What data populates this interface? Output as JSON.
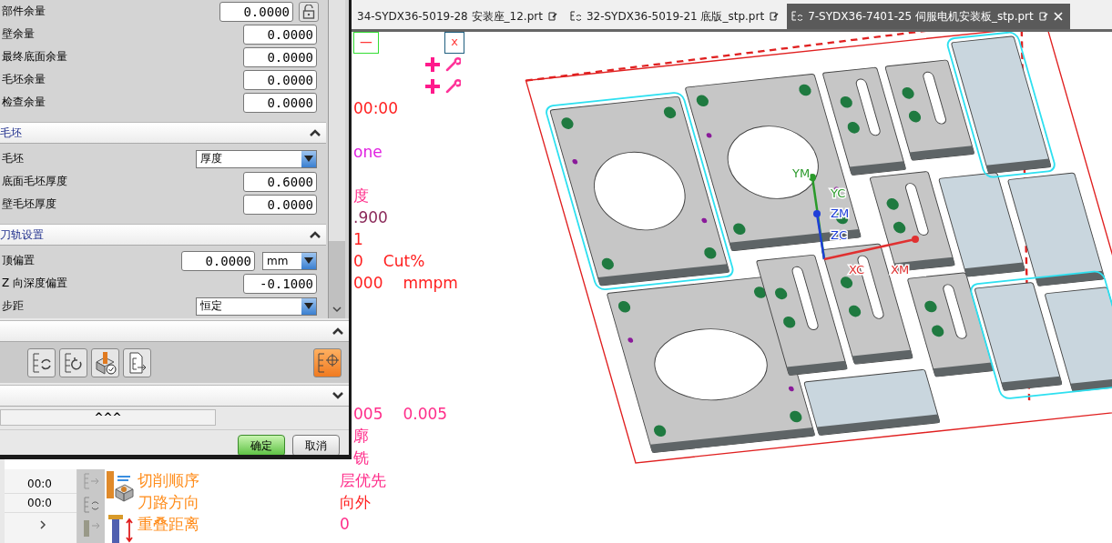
{
  "dialog": {
    "sections": [
      {
        "kind": "plain",
        "rows": [
          {
            "kind": "number_lock",
            "label": "部件余量",
            "value": "0.0000"
          },
          {
            "kind": "number",
            "label": "壁余量",
            "value": "0.0000"
          },
          {
            "kind": "number",
            "label": "最终底面余量",
            "value": "0.0000"
          },
          {
            "kind": "number",
            "label": "毛坯余量",
            "value": "0.0000"
          },
          {
            "kind": "number",
            "label": "检查余量",
            "value": "0.0000"
          }
        ]
      },
      {
        "kind": "group",
        "title": "毛坯",
        "expanded": true,
        "rows": [
          {
            "kind": "dropdown",
            "label": "毛坯",
            "value": "厚度"
          },
          {
            "kind": "number",
            "label": "底面毛坯厚度",
            "value": "0.6000"
          },
          {
            "kind": "number",
            "label": "壁毛坯厚度",
            "value": "0.0000"
          }
        ]
      },
      {
        "kind": "group",
        "title": "刀轨设置",
        "expanded": true,
        "rows": [
          {
            "kind": "number_unit",
            "label": "顶偏置",
            "value": "0.0000",
            "unit": "mm"
          },
          {
            "kind": "number",
            "label": "Z 向深度偏置",
            "value": "-0.1000"
          },
          {
            "kind": "dropdown",
            "label": "步距",
            "value": "恒定"
          }
        ]
      }
    ],
    "actions": {
      "expanded": true,
      "tools": [
        {
          "kind": "generate",
          "selected": false
        },
        {
          "kind": "replay",
          "selected": false
        },
        {
          "kind": "verify",
          "selected": false
        },
        {
          "kind": "list",
          "selected": false
        },
        {
          "kind": "display",
          "selected": true
        }
      ]
    },
    "options": {
      "expanded": false
    },
    "more_toggle": "^^^",
    "buttons": [
      {
        "label": "确定",
        "default": true
      },
      {
        "label": "取消",
        "default": false
      }
    ]
  },
  "tabs": [
    {
      "label": "34-SYDX36-5019-28 安装座_12.prt",
      "selected": false
    },
    {
      "label": "32-SYDX36-5019-21 底版_stp.prt",
      "kind": "synced",
      "selected": false
    },
    {
      "label": "7-SYDX36-7401-25 伺服电机安装板_stp.prt",
      "kind": "synced",
      "selected": true
    }
  ],
  "params": {
    "controls": [
      {
        "kind": "minimize",
        "label": "一"
      },
      {
        "kind": "close",
        "label": "x"
      }
    ],
    "add_rows": [
      {
        "kind": "add"
      },
      {
        "kind": "add"
      }
    ],
    "rows": [
      {
        "kind": "value_only",
        "values": [
          {
            "text": "00:00",
            "color": "#ff2020"
          }
        ]
      },
      {
        "kind": "blank"
      },
      {
        "kind": "value_only",
        "values": [
          {
            "text": "one",
            "color": "#e020e0"
          }
        ]
      },
      {
        "kind": "blank"
      },
      {
        "kind": "value_only",
        "values": [
          {
            "text": "度",
            "color": "#ff2d8a"
          }
        ]
      },
      {
        "kind": "value_only",
        "values": [
          {
            "text": ".900",
            "color": "#8b2a5a"
          }
        ]
      },
      {
        "kind": "value_only",
        "values": [
          {
            "text": "1",
            "color": "#ff2020"
          }
        ]
      },
      {
        "kind": "value_only",
        "values": [
          {
            "text": "0",
            "color": "#ff2020"
          },
          {
            "text": "Cut%",
            "color": "#ff2020"
          }
        ]
      },
      {
        "kind": "value_only",
        "values": [
          {
            "text": "000",
            "color": "#ff2020"
          },
          {
            "text": "mmpm",
            "color": "#ff2020"
          }
        ]
      },
      {
        "kind": "blank"
      },
      {
        "kind": "blank"
      },
      {
        "kind": "blank"
      },
      {
        "kind": "blank"
      },
      {
        "kind": "blank"
      },
      {
        "kind": "value_only",
        "values": [
          {
            "text": "005",
            "color": "#ff2d8a"
          },
          {
            "text": "0.005",
            "color": "#ff2d8a"
          }
        ]
      },
      {
        "kind": "value_only",
        "values": [
          {
            "text": "廓",
            "color": "#ff2d8a"
          }
        ]
      },
      {
        "kind": "value_only",
        "values": [
          {
            "text": "铣",
            "color": "#ff2d8a"
          }
        ]
      }
    ]
  },
  "lower": {
    "table_cells": [
      "00:0",
      "00:0"
    ],
    "tools": [
      {
        "kind": "list"
      },
      {
        "kind": "replay"
      },
      {
        "kind": "cutter"
      }
    ],
    "rows": [
      {
        "label": "切削顺序",
        "values": [
          {
            "text": "层优先",
            "color": "#ff2d8a"
          }
        ]
      },
      {
        "label": "刀路方向",
        "values": [
          {
            "text": "向外",
            "color": "#ff2020"
          }
        ]
      },
      {
        "label": "重叠距离",
        "values": [
          {
            "text": "0",
            "color": "#ff2d8a"
          }
        ]
      }
    ]
  },
  "viewport": {
    "axes": [
      {
        "kind": "y",
        "labels": [
          "YM",
          "YC"
        ]
      },
      {
        "kind": "z",
        "labels": [
          "ZM",
          "ZC"
        ]
      },
      {
        "kind": "x",
        "labels": [
          "XC",
          "XM"
        ]
      }
    ]
  }
}
